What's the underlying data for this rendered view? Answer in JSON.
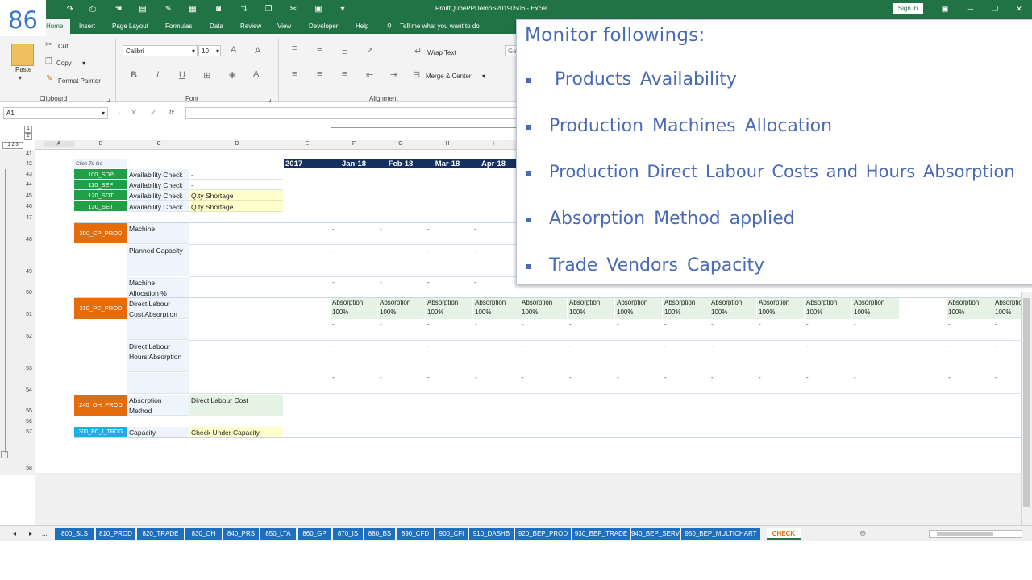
{
  "slide_number": "86",
  "window": {
    "title": "ProiftQubePPDemoS20190506 - Excel",
    "signin": "Sign in"
  },
  "ribbon_tabs": [
    "Home",
    "Insert",
    "Page Layout",
    "Formulas",
    "Data",
    "Review",
    "View",
    "Developer",
    "Help"
  ],
  "tell_me": "Tell me what you want to do",
  "clipboard": {
    "paste": "Paste",
    "cut": "Cut",
    "copy": "Copy",
    "format_painter": "Format Painter",
    "group": "Clipboard"
  },
  "font": {
    "name": "Calibri",
    "size": "10",
    "group": "Font"
  },
  "alignment": {
    "wrap": "Wrap Text",
    "merge": "Merge & Center",
    "group": "Alignment"
  },
  "number_fmt": "Ge",
  "formula_bar": {
    "name_box": "A1",
    "fx": "fx"
  },
  "columns": [
    "A",
    "B",
    "C",
    "D",
    "E",
    "F",
    "G",
    "H",
    "I"
  ],
  "rows": [
    "41",
    "42",
    "43",
    "44",
    "45",
    "46",
    "47",
    "48",
    "49",
    "50",
    "51",
    "52",
    "53",
    "54",
    "55",
    "56",
    "57",
    "58"
  ],
  "grid": {
    "click_to_go": "Click To Go",
    "year": "2017",
    "months": [
      "Jan-18",
      "Feb-18",
      "Mar-18",
      "Apr-18"
    ],
    "checks": [
      {
        "code": "100_SDP",
        "label": "Availability Check",
        "value": "-"
      },
      {
        "code": "110_SEP",
        "label": "Availability Check",
        "value": "-"
      },
      {
        "code": "120_SDT",
        "label": "Availability Check",
        "value": "Q.ty Shortage"
      },
      {
        "code": "130_SET",
        "label": "Availability Check",
        "value": "Q.ty Shortage"
      }
    ],
    "prod": {
      "code": "200_CP_PROD",
      "machine": "Machine",
      "planned": "Planned Capacity",
      "alloc1": "Machine",
      "alloc2": "Allocation %"
    },
    "pc": {
      "code": "210_PC_PROD",
      "dl1": "Direct Labour",
      "dl2": "Cost Absorption",
      "dlh1": "Direct Labour",
      "dlh2": "Hours Absorption"
    },
    "absorption": {
      "label": "Absorption",
      "value": "100%"
    },
    "oh": {
      "code": "240_OH_PROD",
      "m1": "Absorption",
      "m2": "Method",
      "value": "Direct Labour Cost"
    },
    "trade": {
      "code": "300_PC_I_TRDG",
      "label": "Capacity",
      "value": "Check Under Capacity"
    },
    "dash": "-"
  },
  "sheet_tabs": [
    "800_SLS",
    "810_PROD",
    "820_TRADE",
    "830_OH",
    "840_PRS",
    "850_LTA",
    "860_GP",
    "870_IS",
    "880_BS",
    "890_CFD",
    "900_CFI",
    "910_DASHB",
    "920_BEP_PROD",
    "930_BEP_TRADE",
    "940_BEP_SERV",
    "950_BEP_MULTICHART",
    "CHECK"
  ],
  "sheet_nav_more": "...",
  "overlay": {
    "title": "Monitor followings:",
    "bullets": [
      "Products Availability",
      "Production Machines Allocation",
      "Production Direct Labour Costs and Hours Absorption",
      "Absorption Method applied",
      "Trade Vendors Capacity"
    ],
    "accent": "#4a6bb4"
  }
}
